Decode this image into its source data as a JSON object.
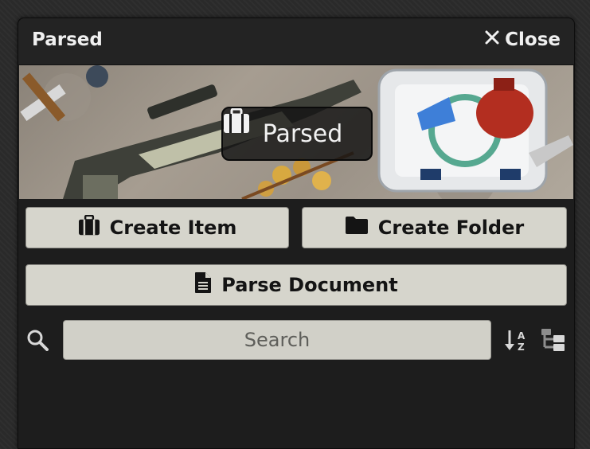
{
  "header": {
    "title": "Parsed",
    "close_label": "Close"
  },
  "banner": {
    "label": "Parsed"
  },
  "actions": {
    "create_item": "Create Item",
    "create_folder": "Create Folder",
    "parse_document": "Parse Document"
  },
  "search": {
    "placeholder": "Search",
    "value": ""
  },
  "icons": {
    "close": "close-icon",
    "banner": "briefcase-icon",
    "create_item": "briefcase-icon",
    "create_folder": "folder-icon",
    "parse_document": "document-icon",
    "search": "search-icon",
    "sort": "sort-alpha-icon",
    "tree": "folder-tree-icon"
  },
  "colors": {
    "panel_bg": "#1d1d1d",
    "button_bg": "#d6d5cc",
    "text_light": "#f0f0f0"
  }
}
